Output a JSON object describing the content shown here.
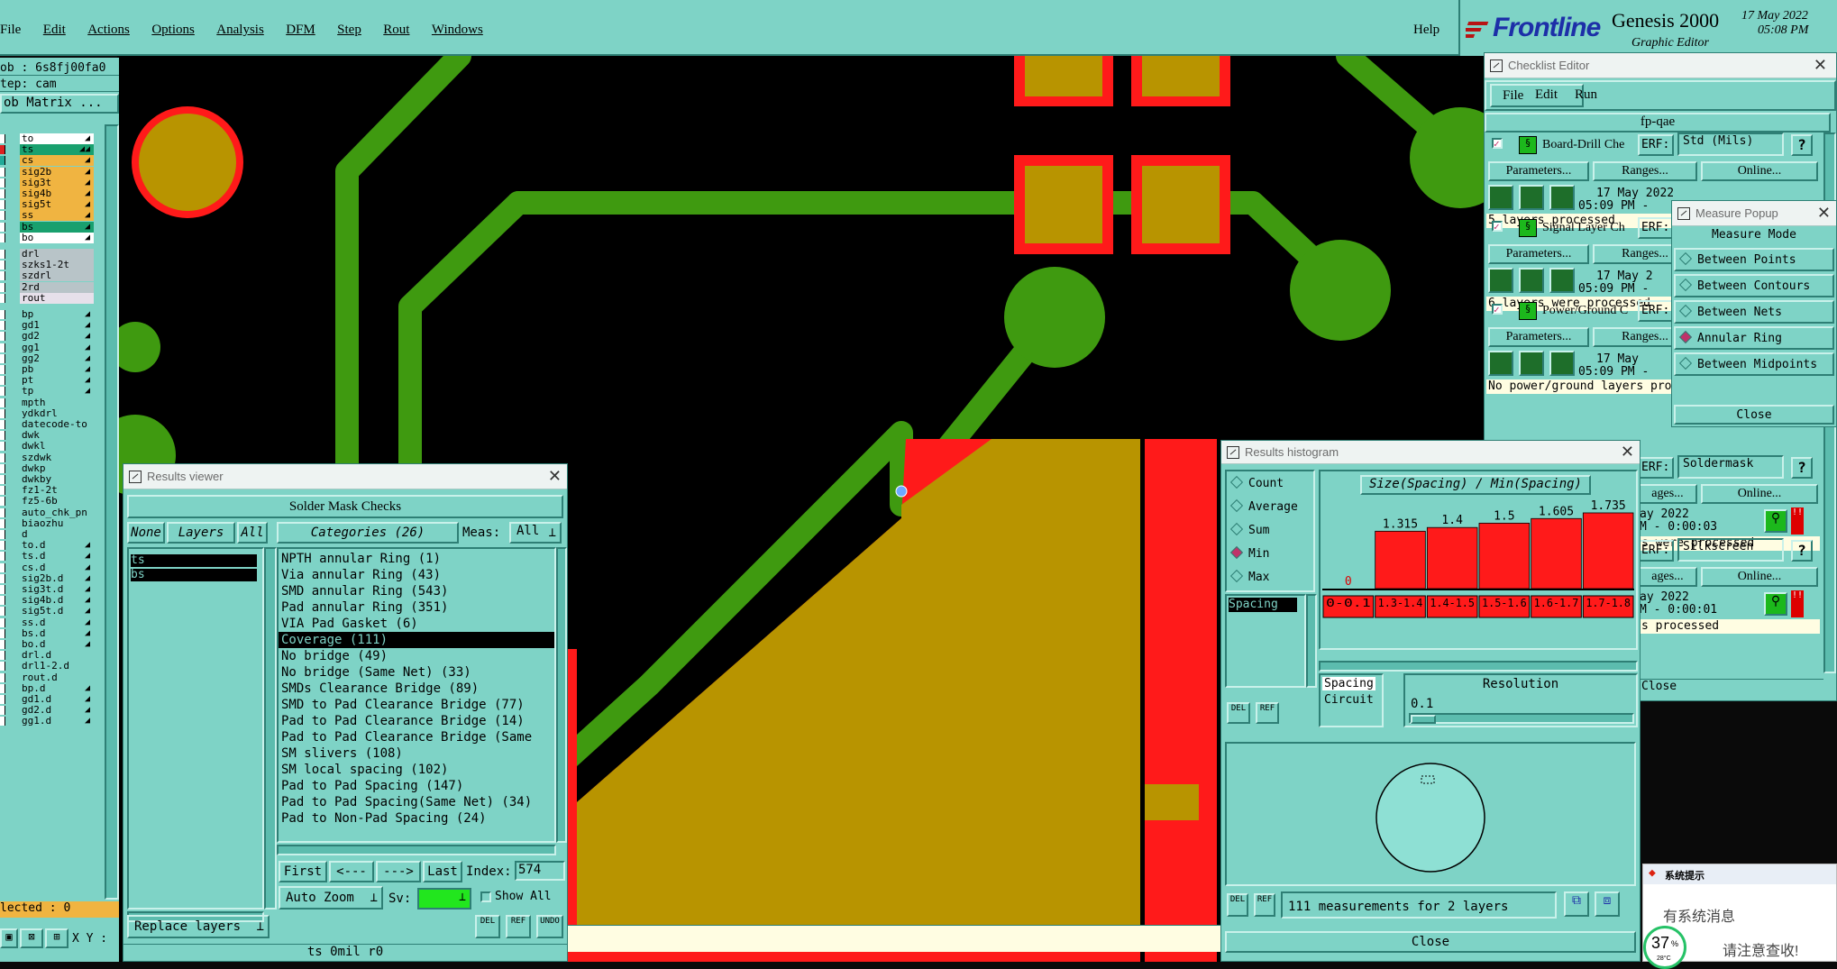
{
  "menubar": {
    "items": [
      "File",
      "Edit",
      "Actions",
      "Options",
      "Analysis",
      "DFM",
      "Step",
      "Rout",
      "Windows"
    ],
    "help": "Help"
  },
  "brand": {
    "logo_text": "Frontline",
    "product": "Genesis 2000",
    "subtitle": "Graphic Editor",
    "date": "17 May 2022",
    "time": "05:08 PM"
  },
  "left_panel": {
    "job": "ob : 6s8fj00fa0",
    "step": "tep: cam",
    "matrix_button": "ob Matrix ...",
    "layers": [
      {
        "name": "to",
        "color": "#ffffff",
        "pen": "◢"
      },
      {
        "name": "ts",
        "color": "#19a06e",
        "pen": "◢◢"
      },
      {
        "name": "cs",
        "color": "#f0b441",
        "pen": "◢"
      },
      {
        "name": "sig2b",
        "color": "#f0b441",
        "pen": "◢"
      },
      {
        "name": "sig3t",
        "color": "#f0b441",
        "pen": "◢"
      },
      {
        "name": "sig4b",
        "color": "#f0b441",
        "pen": "◢"
      },
      {
        "name": "sig5t",
        "color": "#f0b441",
        "pen": "◢"
      },
      {
        "name": "ss",
        "color": "#f0b441",
        "pen": "◢"
      },
      {
        "name": "bs",
        "color": "#19a06e",
        "pen": "◢"
      },
      {
        "name": "bo",
        "color": "#ffffff",
        "pen": "◢"
      },
      {
        "name": "drl",
        "color": "#b8c4c8",
        "pen": ""
      },
      {
        "name": "szks1-2t",
        "color": "#b8c4c8",
        "pen": ""
      },
      {
        "name": "szdrl",
        "color": "#b8c4c8",
        "pen": ""
      },
      {
        "name": "2rd",
        "color": "#b8c4c8",
        "pen": ""
      },
      {
        "name": "rout",
        "color": "#e6e0ea",
        "pen": ""
      },
      {
        "name": "bp",
        "color": "#7ed3c6",
        "pen": "◢"
      },
      {
        "name": "gd1",
        "color": "#7ed3c6",
        "pen": "◢"
      },
      {
        "name": "gd2",
        "color": "#7ed3c6",
        "pen": "◢"
      },
      {
        "name": "gg1",
        "color": "#7ed3c6",
        "pen": "◢"
      },
      {
        "name": "gg2",
        "color": "#7ed3c6",
        "pen": "◢"
      },
      {
        "name": "pb",
        "color": "#7ed3c6",
        "pen": "◢"
      },
      {
        "name": "pt",
        "color": "#7ed3c6",
        "pen": "◢"
      },
      {
        "name": "tp",
        "color": "#7ed3c6",
        "pen": "◢"
      },
      {
        "name": "mpth",
        "color": "#7ed3c6",
        "pen": ""
      },
      {
        "name": "ydkdrl",
        "color": "#7ed3c6",
        "pen": ""
      },
      {
        "name": "datecode-to",
        "color": "#7ed3c6",
        "pen": ""
      },
      {
        "name": "dwk",
        "color": "#7ed3c6",
        "pen": ""
      },
      {
        "name": "dwkl",
        "color": "#7ed3c6",
        "pen": ""
      },
      {
        "name": "szdwk",
        "color": "#7ed3c6",
        "pen": ""
      },
      {
        "name": "dwkp",
        "color": "#7ed3c6",
        "pen": ""
      },
      {
        "name": "dwkby",
        "color": "#7ed3c6",
        "pen": ""
      },
      {
        "name": "fz1-2t",
        "color": "#7ed3c6",
        "pen": ""
      },
      {
        "name": "fz5-6b",
        "color": "#7ed3c6",
        "pen": ""
      },
      {
        "name": "auto_chk_pn",
        "color": "#7ed3c6",
        "pen": ""
      },
      {
        "name": "biaozhu",
        "color": "#7ed3c6",
        "pen": ""
      },
      {
        "name": "d",
        "color": "#7ed3c6",
        "pen": ""
      },
      {
        "name": "to.d",
        "color": "#7ed3c6",
        "pen": "◢"
      },
      {
        "name": "ts.d",
        "color": "#7ed3c6",
        "pen": "◢"
      },
      {
        "name": "cs.d",
        "color": "#7ed3c6",
        "pen": "◢"
      },
      {
        "name": "sig2b.d",
        "color": "#7ed3c6",
        "pen": "◢"
      },
      {
        "name": "sig3t.d",
        "color": "#7ed3c6",
        "pen": "◢"
      },
      {
        "name": "sig4b.d",
        "color": "#7ed3c6",
        "pen": "◢"
      },
      {
        "name": "sig5t.d",
        "color": "#7ed3c6",
        "pen": "◢"
      },
      {
        "name": "ss.d",
        "color": "#7ed3c6",
        "pen": "◢"
      },
      {
        "name": "bs.d",
        "color": "#7ed3c6",
        "pen": "◢"
      },
      {
        "name": "bo.d",
        "color": "#7ed3c6",
        "pen": "◢"
      },
      {
        "name": "drl.d",
        "color": "#7ed3c6",
        "pen": ""
      },
      {
        "name": "drl1-2.d",
        "color": "#7ed3c6",
        "pen": ""
      },
      {
        "name": "rout.d",
        "color": "#7ed3c6",
        "pen": ""
      },
      {
        "name": "bp.d",
        "color": "#7ed3c6",
        "pen": "◢"
      },
      {
        "name": "gd1.d",
        "color": "#7ed3c6",
        "pen": "◢"
      },
      {
        "name": "gd2.d",
        "color": "#7ed3c6",
        "pen": "◢"
      },
      {
        "name": "gg1.d",
        "color": "#7ed3c6",
        "pen": "◢"
      }
    ],
    "selected": "lected : 0",
    "xy_label": "X Y :"
  },
  "results_viewer": {
    "title": "Results viewer",
    "header": "Solder Mask Checks",
    "none_btn": "None",
    "layers_btn": "Layers",
    "all_btn": "All",
    "categories_label": "Categories (26)",
    "meas_label": "Meas:",
    "meas_value": "All",
    "layers": [
      "ts",
      "bs"
    ],
    "categories": [
      "NPTH annular Ring (1)",
      "Via annular Ring (43)",
      "SMD annular Ring (543)",
      "Pad annular Ring (351)",
      "VIA Pad Gasket (6)",
      "Coverage (111)",
      "No bridge (49)",
      "No bridge (Same Net) (33)",
      "SMDs Clearance Bridge (89)",
      "SMD to Pad Clearance Bridge (77)",
      "Pad to Pad Clearance Bridge (14)",
      "Pad to Pad Clearance Bridge (Same",
      "SM slivers (108)",
      "SM local spacing (102)",
      "Pad to Pad Spacing (147)",
      "Pad to Pad Spacing(Same Net) (34)",
      "Pad to Non-Pad Spacing (24)"
    ],
    "selected_category": 5,
    "first": "First",
    "prev": "<---",
    "next": "--->",
    "last": "Last",
    "index_label": "Index:",
    "index_value": "574",
    "auto_zoom": "Auto Zoom",
    "sv_label": "Sv:",
    "show_all": "Show All",
    "replace_layers": "Replace layers",
    "del": "DEL",
    "ref": "REF",
    "undo": "UNDO",
    "status": "ts 0mil  r0"
  },
  "checklist_editor": {
    "title": "Checklist Editor",
    "menu": [
      "File",
      "Edit",
      "Run"
    ],
    "name": "fp-qae",
    "checks": [
      {
        "name": "Board-Drill Che",
        "erf": "ERF:",
        "erf_value": "Std (Mils)",
        "date": "17 May 2022",
        "time": "05:09 PM -",
        "status": "5 layers processed"
      },
      {
        "name": "Signal Layer Ch",
        "erf": "ERF:",
        "erf_value": "",
        "date": "17 May 2",
        "time": "05:09 PM -",
        "status": "6 layers were processed"
      },
      {
        "name": "Power/Ground C",
        "erf": "ERF:",
        "erf_value": "",
        "date": "17 May",
        "time": "05:09 PM -",
        "status": "No power/ground layers processed"
      }
    ],
    "extra_checks": [
      {
        "erf_value": "Soldermask",
        "date": "ay 2022",
        "time": "M - 0:00:03",
        "status": "s were processed"
      },
      {
        "erf_value": "Silkscreen",
        "date": "ay 2022",
        "time": "M - 0:00:01",
        "status": "s processed"
      }
    ],
    "parameters": "Parameters...",
    "ranges": "Ranges...",
    "online": "Online...",
    "ages": "ages...",
    "close": "Close"
  },
  "measure_popup": {
    "title": "Measure Popup",
    "mode_label": "Measure Mode",
    "modes": [
      "Between Points",
      "Between Contours",
      "Between Nets",
      "Annular Ring",
      "Between Midpoints"
    ],
    "selected_mode": 3,
    "close": "Close"
  },
  "results_histogram": {
    "title": "Results histogram",
    "options": [
      "Count",
      "Average",
      "Sum",
      "Min",
      "Max"
    ],
    "selected_option": 3,
    "list_item": "Spacing",
    "chart_title": "Size(Spacing) / Min(Spacing)",
    "resolution_label": "Resolution",
    "resolution_value": "0.1",
    "spacing_label": "Spacing",
    "circuit_label": "Circuit",
    "summary": "111 measurements for 2 layers",
    "close": "Close",
    "del": "DEL",
    "ref": "REF"
  },
  "chart_data": {
    "type": "bar",
    "title": "Size(Spacing) / Min(Spacing)",
    "categories": [
      "0-0.1",
      "1.3-1.4",
      "1.4-1.5",
      "1.5-1.6",
      "1.6-1.7",
      "1.7-1.8"
    ],
    "values": [
      0,
      1.315,
      1.4,
      1.5,
      1.605,
      1.735
    ],
    "value_labels": [
      "0",
      "1.315",
      "1.4",
      "1.5",
      "1.605",
      "1.735"
    ],
    "ymax": 1.9,
    "bar_color": "#ff1a1a"
  },
  "system_notice": {
    "title": "系统提示",
    "line1": "有系统消息",
    "line2": "请注意查收!",
    "percent": "37",
    "percent_unit": "%",
    "temp": "28°C"
  },
  "colors": {
    "panel": "#7ed3c6",
    "copper": "#b89400",
    "trace": "#3f9a10",
    "mask": "#ff1a1a"
  }
}
